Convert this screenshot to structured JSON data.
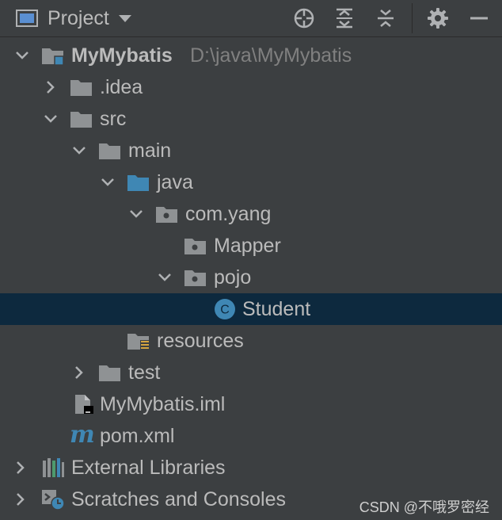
{
  "header": {
    "title": "Project",
    "tools": [
      "locate-icon",
      "expand-all-icon",
      "collapse-all-icon",
      "gear-icon",
      "minimize-icon"
    ]
  },
  "tree": {
    "root": {
      "label": "MyMybatis",
      "path": "D:\\java\\MyMybatis"
    },
    "idea": {
      "label": ".idea"
    },
    "src": {
      "label": "src"
    },
    "main": {
      "label": "main"
    },
    "java": {
      "label": "java"
    },
    "comyang": {
      "label": "com.yang"
    },
    "mapper": {
      "label": "Mapper"
    },
    "pojo": {
      "label": "pojo"
    },
    "student": {
      "label": "Student",
      "class_badge": "C"
    },
    "resources": {
      "label": "resources"
    },
    "test": {
      "label": "test"
    },
    "iml": {
      "label": "MyMybatis.iml"
    },
    "pom": {
      "label": "pom.xml",
      "badge": "m"
    },
    "libs": {
      "label": "External Libraries"
    },
    "scratches": {
      "label": "Scratches and Consoles"
    }
  },
  "watermark": "CSDN @不哦罗密经",
  "colors": {
    "background": "#3c3f41",
    "selection": "#0d293e",
    "text": "#bbbbbb",
    "path_text": "#808080",
    "folder": "#8f9294",
    "source_folder": "#3f87b4",
    "class_badge": "#3f87b4",
    "maven_blue": "#3f87b4"
  }
}
